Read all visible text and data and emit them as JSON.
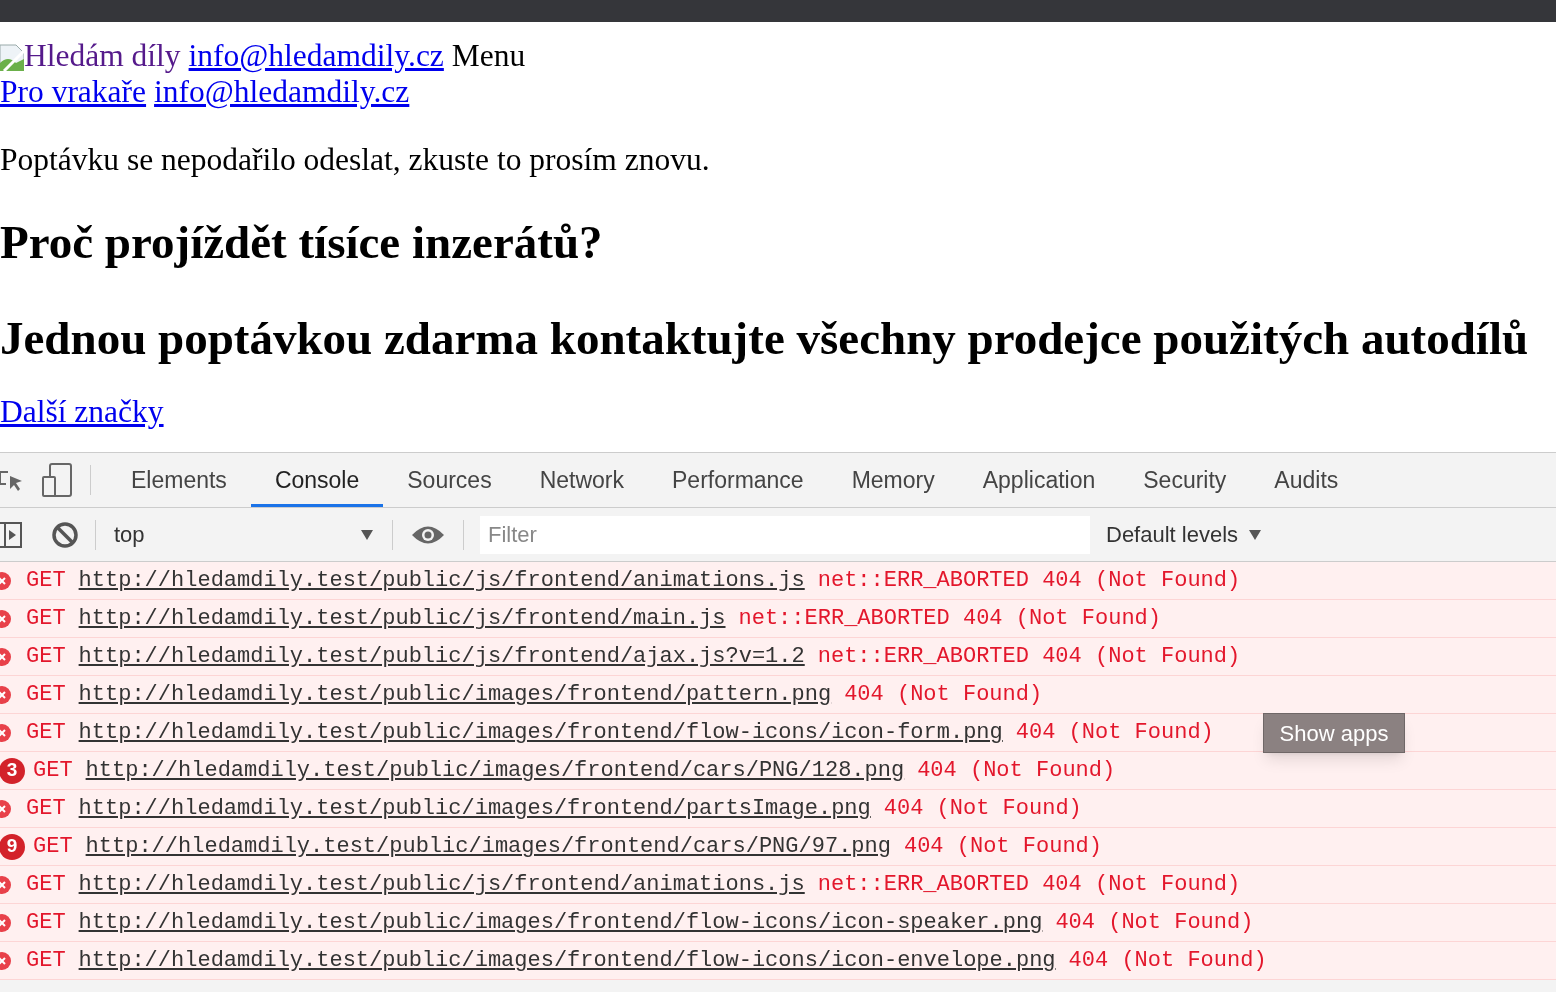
{
  "page": {
    "logo_alt": "Hledám díly",
    "header_email": "info@hledamdily.cz",
    "menu": "Menu",
    "nav_link": "Pro vrakaře",
    "nav_email": "info@hledamdily.cz",
    "error_message": "Poptávku se nepodařilo odeslat, zkuste to prosím znovu.",
    "heading_1": "Proč projíždět tísíce inzerátů?",
    "heading_2": "Jednou poptávkou zdarma kontaktujte všechny prodejce použitých autodílů",
    "more_brands": "Další značky"
  },
  "devtools": {
    "tabs": [
      {
        "label": "Elements",
        "selected": false
      },
      {
        "label": "Console",
        "selected": true
      },
      {
        "label": "Sources",
        "selected": false
      },
      {
        "label": "Network",
        "selected": false
      },
      {
        "label": "Performance",
        "selected": false
      },
      {
        "label": "Memory",
        "selected": false
      },
      {
        "label": "Application",
        "selected": false
      },
      {
        "label": "Security",
        "selected": false
      },
      {
        "label": "Audits",
        "selected": false
      }
    ],
    "context": "top",
    "filter": {
      "placeholder": "Filter"
    },
    "levels": "Default levels",
    "messages": [
      {
        "kind": "error",
        "method": "GET",
        "url": "http://hledamdily.test/public/js/frontend/animations.js",
        "status": "net::ERR_ABORTED 404 (Not Found)"
      },
      {
        "kind": "error",
        "method": "GET",
        "url": "http://hledamdily.test/public/js/frontend/main.js",
        "status": "net::ERR_ABORTED 404 (Not Found)"
      },
      {
        "kind": "error",
        "method": "GET",
        "url": "http://hledamdily.test/public/js/frontend/ajax.js?v=1.2",
        "status": "net::ERR_ABORTED 404 (Not Found)"
      },
      {
        "kind": "error",
        "method": "GET",
        "url": "http://hledamdily.test/public/images/frontend/pattern.png",
        "status": "404 (Not Found)"
      },
      {
        "kind": "error",
        "method": "GET",
        "url": "http://hledamdily.test/public/images/frontend/flow-icons/icon-form.png",
        "status": "404 (Not Found)"
      },
      {
        "kind": "repeated",
        "count": "3",
        "method": "GET",
        "url": "http://hledamdily.test/public/images/frontend/cars/PNG/128.png",
        "status": "404 (Not Found)"
      },
      {
        "kind": "error",
        "method": "GET",
        "url": "http://hledamdily.test/public/images/frontend/partsImage.png",
        "status": "404 (Not Found)"
      },
      {
        "kind": "repeated",
        "count": "9",
        "method": "GET",
        "url": "http://hledamdily.test/public/images/frontend/cars/PNG/97.png",
        "status": "404 (Not Found)"
      },
      {
        "kind": "error",
        "method": "GET",
        "url": "http://hledamdily.test/public/js/frontend/animations.js",
        "status": "net::ERR_ABORTED 404 (Not Found)"
      },
      {
        "kind": "error",
        "method": "GET",
        "url": "http://hledamdily.test/public/images/frontend/flow-icons/icon-speaker.png",
        "status": "404 (Not Found)"
      },
      {
        "kind": "error",
        "method": "GET",
        "url": "http://hledamdily.test/public/images/frontend/flow-icons/icon-envelope.png",
        "status": "404 (Not Found)"
      }
    ]
  },
  "tooltip": "Show apps"
}
